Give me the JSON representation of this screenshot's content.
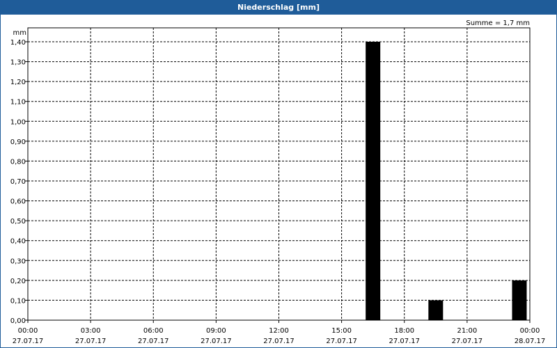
{
  "window": {
    "title": "Niederschlag [mm]"
  },
  "summary": "Summe = 1,7 mm",
  "colors": {
    "titlebar": "#1f5c99",
    "bar": "#000000",
    "grid": "#000000"
  },
  "chart_data": {
    "type": "bar",
    "title": "Niederschlag [mm]",
    "ylabel": "mm",
    "xlabel": "",
    "ylim": [
      0,
      1.4
    ],
    "grid": true,
    "y_ticks": [
      "0,00",
      "0,10",
      "0,20",
      "0,30",
      "0,40",
      "0,50",
      "0,60",
      "0,70",
      "0,80",
      "0,90",
      "1,00",
      "1,10",
      "1,20",
      "1,30",
      "1,40"
    ],
    "x_ticks": [
      {
        "time": "00:00",
        "date": "27.07.17"
      },
      {
        "time": "03:00",
        "date": "27.07.17"
      },
      {
        "time": "06:00",
        "date": "27.07.17"
      },
      {
        "time": "09:00",
        "date": "27.07.17"
      },
      {
        "time": "12:00",
        "date": "27.07.17"
      },
      {
        "time": "15:00",
        "date": "27.07.17"
      },
      {
        "time": "18:00",
        "date": "27.07.17"
      },
      {
        "time": "21:00",
        "date": "27.07.17"
      },
      {
        "time": "00:00",
        "date": "28.07.17"
      }
    ],
    "bars": [
      {
        "time": "27.07.17 16:30",
        "value": 1.4
      },
      {
        "time": "27.07.17 19:30",
        "value": 0.1
      },
      {
        "time": "27.07.17 23:30",
        "value": 0.2
      }
    ]
  }
}
